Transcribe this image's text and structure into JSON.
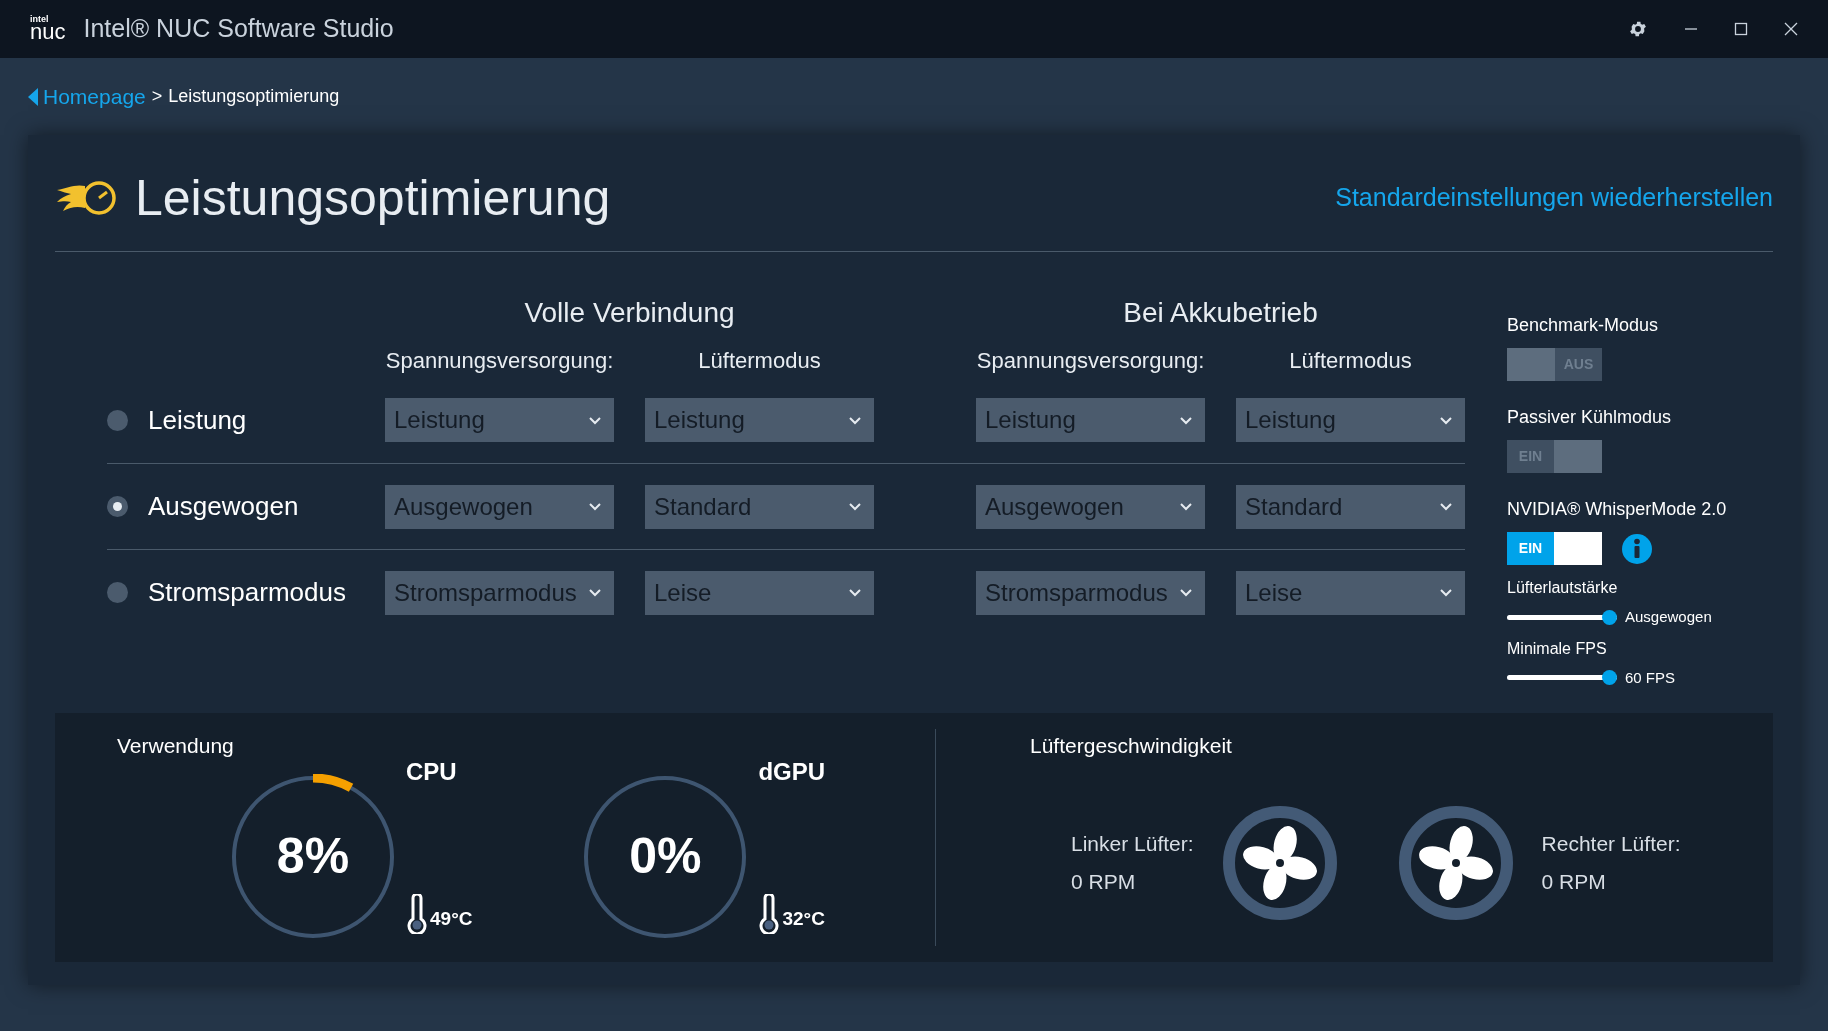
{
  "window": {
    "logo": [
      "intel",
      "nuc"
    ],
    "title": "Intel® NUC Software Studio"
  },
  "breadcrumb": {
    "link": "Homepage",
    "separator": ">",
    "current": "Leistungsoptimierung"
  },
  "page": {
    "title": "Leistungsoptimierung",
    "reset_link": "Standardeinstellungen wiederherstellen"
  },
  "groups": [
    {
      "title": "Volle Verbindung",
      "columns": [
        "Spannungsversorgung:",
        "Lüftermodus"
      ]
    },
    {
      "title": "Bei Akkubetrieb",
      "columns": [
        "Spannungsversorgung:",
        "Lüftermodus"
      ]
    }
  ],
  "profiles": [
    {
      "label": "Leistung",
      "selected": false,
      "values": [
        "Leistung",
        "Leistung",
        "Leistung",
        "Leistung"
      ]
    },
    {
      "label": "Ausgewogen",
      "selected": true,
      "values": [
        "Ausgewogen",
        "Standard",
        "Ausgewogen",
        "Standard"
      ]
    },
    {
      "label": "Stromsparmodus",
      "selected": false,
      "values": [
        "Stromsparmodus",
        "Leise",
        "Stromsparmodus",
        "Leise"
      ]
    }
  ],
  "toggles": [
    {
      "label": "Benchmark-Modus",
      "on": false,
      "disabled": true,
      "state_text": "AUS",
      "info": false
    },
    {
      "label": "Passiver Kühlmodus",
      "on": true,
      "disabled": true,
      "state_text": "EIN",
      "info": false
    },
    {
      "label": "NVIDIA® WhisperMode 2.0",
      "on": true,
      "disabled": false,
      "state_text": "EIN",
      "info": true
    }
  ],
  "sliders": [
    {
      "label": "Lüfterlautstärke",
      "level": 1,
      "reading": "Ausgewogen"
    },
    {
      "label": "Minimale FPS",
      "level": 1,
      "reading": "60 FPS"
    }
  ],
  "usage": {
    "title": "Verwendung",
    "gauges": [
      {
        "name": "CPU",
        "value": "8%",
        "level": 0.08,
        "temperature": "49°C"
      },
      {
        "name": "dGPU",
        "value": "0%",
        "level": 0,
        "temperature": "32°C"
      }
    ]
  },
  "fans": {
    "title": "Lüftergeschwindigkeit",
    "items": [
      {
        "label": "Linker Lüfter:",
        "reading": "0 RPM"
      },
      {
        "label": "Rechter Lüfter:",
        "reading": "0 RPM"
      }
    ]
  }
}
